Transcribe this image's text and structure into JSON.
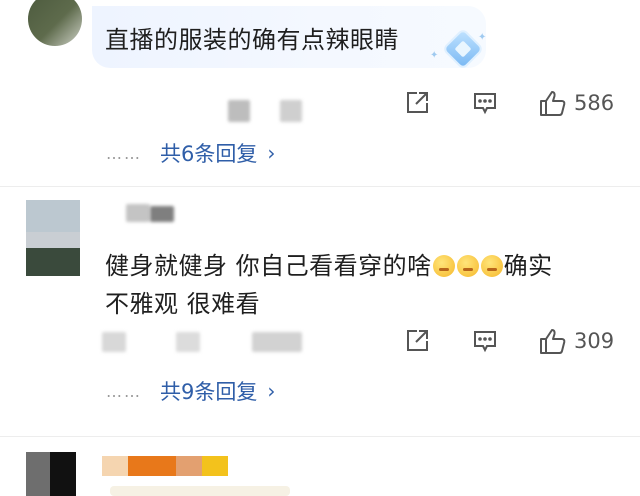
{
  "comments": [
    {
      "text": "直播的服装的确有点辣眼睛",
      "actions": {
        "likes": "586"
      },
      "replies_label": "共6条回复"
    },
    {
      "text_line1": "健身就健身  你自己看看穿的啥",
      "text_line1b": "确实",
      "text_line2": "不雅观 很难看",
      "actions": {
        "likes": "309"
      },
      "replies_label": "共9条回复"
    }
  ],
  "icons": {
    "share": "share-icon",
    "comment": "comment-icon",
    "like": "thumbs-up-icon",
    "chevron": "chevron-right-icon",
    "badge": "diamond-badge-icon",
    "emoji": "sweating-face-emoji"
  },
  "colors": {
    "link_blue": "#2f5ea8",
    "bubble_bg": "#eef4ff",
    "text": "#1f1f1f",
    "muted": "#555555"
  },
  "ui": {
    "dots": "……",
    "chevron_glyph": "›"
  }
}
